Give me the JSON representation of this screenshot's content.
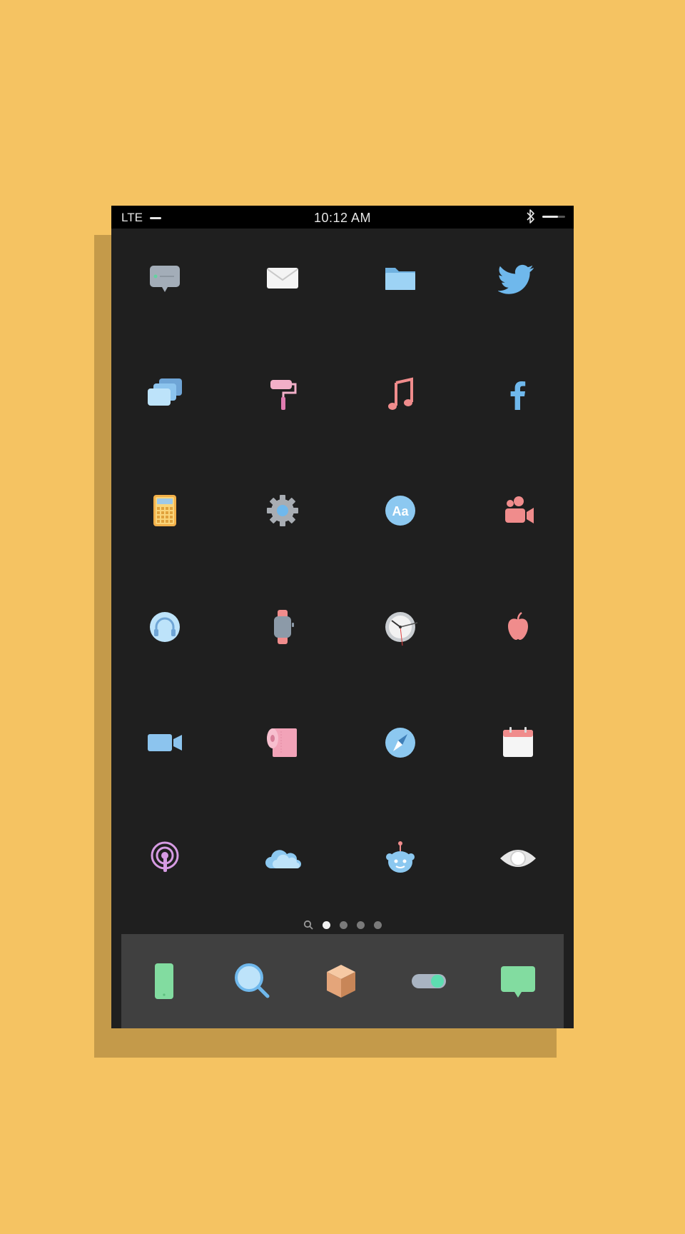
{
  "status_bar": {
    "carrier": "LTE",
    "time": "10:12 AM",
    "bluetooth_icon": "bluetooth-icon"
  },
  "home_screen": {
    "apps": [
      {
        "icon": "chat-bubble-icon"
      },
      {
        "icon": "mail-icon"
      },
      {
        "icon": "folder-icon"
      },
      {
        "icon": "twitter-bird-icon"
      },
      {
        "icon": "stacked-cards-icon"
      },
      {
        "icon": "paint-roller-icon"
      },
      {
        "icon": "music-note-icon"
      },
      {
        "icon": "facebook-icon"
      },
      {
        "icon": "calculator-icon"
      },
      {
        "icon": "gear-icon"
      },
      {
        "icon": "dictionary-icon",
        "label": "Aa"
      },
      {
        "icon": "group-video-icon"
      },
      {
        "icon": "headphones-icon"
      },
      {
        "icon": "smartwatch-icon"
      },
      {
        "icon": "clock-icon"
      },
      {
        "icon": "apple-icon"
      },
      {
        "icon": "video-camera-icon"
      },
      {
        "icon": "toilet-paper-icon"
      },
      {
        "icon": "compass-icon"
      },
      {
        "icon": "calendar-icon"
      },
      {
        "icon": "podcast-icon"
      },
      {
        "icon": "cloud-icon"
      },
      {
        "icon": "robot-icon"
      },
      {
        "icon": "eye-icon"
      }
    ]
  },
  "page_indicator": {
    "pages": 4,
    "active_page": 1,
    "search_icon": "search-icon"
  },
  "dock": {
    "apps": [
      {
        "icon": "phone-icon"
      },
      {
        "icon": "magnifier-icon"
      },
      {
        "icon": "package-box-icon"
      },
      {
        "icon": "toggle-switch-icon"
      },
      {
        "icon": "message-icon"
      }
    ]
  },
  "colors": {
    "background": "#F5C362",
    "shadow": "#C49A4A",
    "screen": "#1F1F1F",
    "dock": "#404040",
    "blue": "#8CC8F0",
    "pink": "#F08C8C",
    "green": "#82DCA0"
  }
}
